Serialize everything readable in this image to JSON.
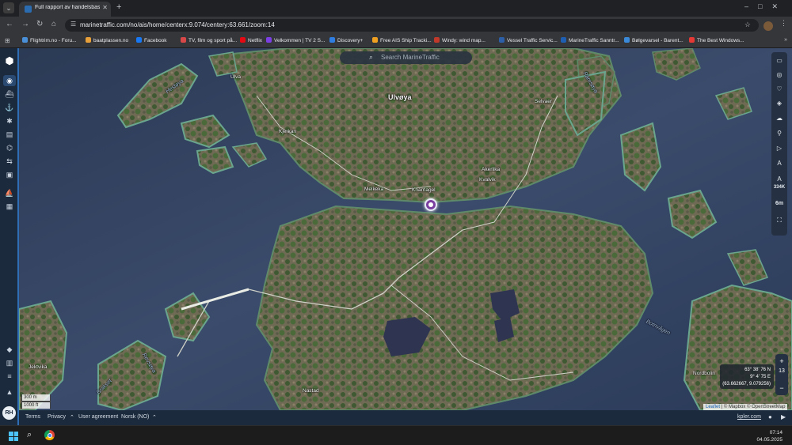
{
  "browser": {
    "tab_title": "Full rapport av handelsbaser i",
    "url": "marinetraffic.com/no/ais/home/centerx:9.074/centery:63.661/zoom:14",
    "bookmarks": [
      {
        "label": "Flightrim.no - Foru...",
        "color": "#4a90d9"
      },
      {
        "label": "baatplassen.no",
        "color": "#e8a13a"
      },
      {
        "label": "Facebook",
        "color": "#1877f2"
      },
      {
        "label": "TV, film og sport på...",
        "color": "#d94848"
      },
      {
        "label": "Netflix",
        "color": "#e50914"
      },
      {
        "label": "Velkommen | TV 2 S...",
        "color": "#7b3fe4"
      },
      {
        "label": "Discovery+",
        "color": "#2f7de1"
      },
      {
        "label": "Free AIS Ship Tracki...",
        "color": "#f0a020"
      },
      {
        "label": "Windy: wind map...",
        "color": "#c0392b"
      },
      {
        "label": "Vessel Traffic Servic...",
        "color": "#2d5fa8"
      },
      {
        "label": "MarineTraffic Sanntr...",
        "color": "#1e5fb4"
      },
      {
        "label": "Bølgevarsel - Barent...",
        "color": "#3b8ad9"
      },
      {
        "label": "The Best Windows...",
        "color": "#e53935"
      }
    ],
    "all_bookmarks": "»"
  },
  "map": {
    "search_placeholder": "Search MarineTraffic",
    "places": {
      "ulvoya": "Ulvøya",
      "selvaer": "Selvaer",
      "kjerkan": "Kjerkan",
      "melkeka": "Melkeka",
      "knarrlagel": "Knarrlagel",
      "akerlika": "Akerlika",
      "kvalvik": "Kvalvik",
      "nordbolin": "Nordbolin",
      "nastad": "Nastad",
      "jektvika": "Jektvika",
      "botnvagen": "Botnvågen",
      "brakset": "Brakset",
      "revsoya": "Revsøya",
      "hesloya": "Hesløya",
      "ulva": "Ulva",
      "ramsoya": "Ramsøya"
    },
    "right_tools": {
      "label_a": "A",
      "label_334k": "334K",
      "label_6m": "6m"
    },
    "scale": {
      "metric": "300 m",
      "imperial": "1000 ft"
    },
    "coords": {
      "lat": "63° 38' 76 N",
      "lon": "9° 4' 75 E",
      "decimal": "(63.662667, 9.079256)"
    },
    "zoom": {
      "level": "13",
      "plus": "+",
      "minus": "−"
    },
    "attribution": {
      "leaflet": "Leaflet",
      "rest": "| © Mapbox © OpenStreetMap"
    }
  },
  "footer": {
    "terms": "Terms",
    "privacy": "Privacy",
    "user_agreement": "User agreement",
    "language": "Norsk (NO)",
    "brand": "kpler.com"
  },
  "sidebar": {
    "avatar_initials": "RH"
  },
  "taskbar": {
    "time": "07:14",
    "date": "04.05.2025"
  }
}
